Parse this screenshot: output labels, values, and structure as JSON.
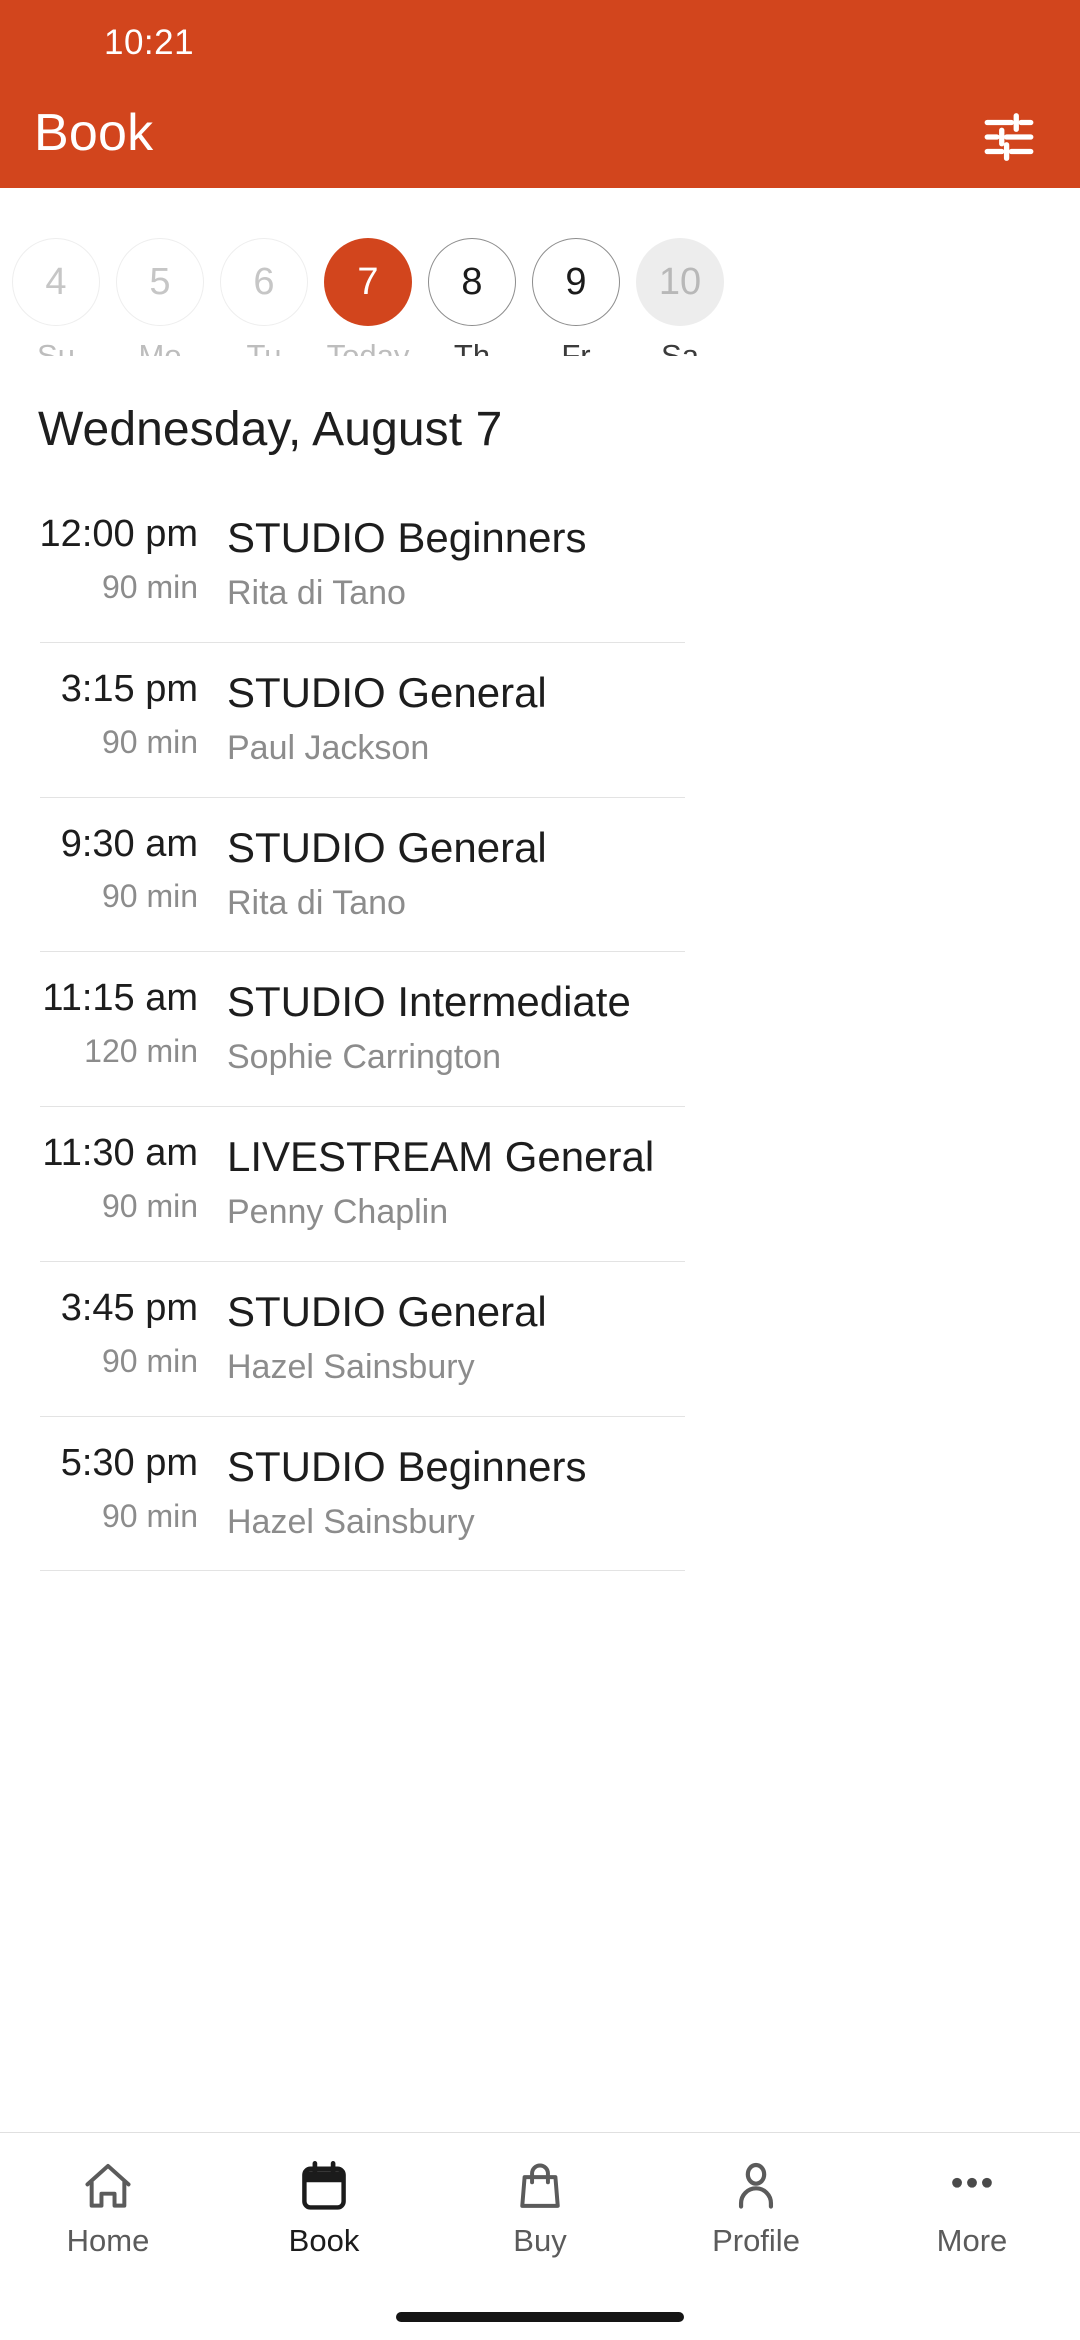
{
  "status_bar": {
    "time": "10:21"
  },
  "app_bar": {
    "title": "Book",
    "filter_icon": "filter-tune-icon",
    "background_color": "#d2451d",
    "text_color": "#ffffff"
  },
  "date_strip": {
    "days": [
      {
        "number": "4",
        "label": "Su",
        "state": "past"
      },
      {
        "number": "5",
        "label": "Mo",
        "state": "past"
      },
      {
        "number": "6",
        "label": "Tu",
        "state": "past"
      },
      {
        "number": "7",
        "label": "Today",
        "state": "today"
      },
      {
        "number": "8",
        "label": "Th",
        "state": "future"
      },
      {
        "number": "9",
        "label": "Fr",
        "state": "future"
      },
      {
        "number": "10",
        "label": "Sa",
        "state": "disabled"
      }
    ],
    "selected_color": "#d2451d"
  },
  "schedule": {
    "date_heading": "Wednesday, August 7",
    "classes": [
      {
        "time": "12:00 pm",
        "duration": "90 min",
        "name": "STUDIO Beginners",
        "instructor": "Rita di Tano"
      },
      {
        "time": "3:15 pm",
        "duration": "90 min",
        "name": "STUDIO General",
        "instructor": "Paul Jackson"
      },
      {
        "time": "9:30 am",
        "duration": "90 min",
        "name": "STUDIO General",
        "instructor": "Rita di Tano"
      },
      {
        "time": "11:15 am",
        "duration": "120 min",
        "name": "STUDIO Intermediate",
        "instructor": "Sophie Carrington"
      },
      {
        "time": "11:30 am",
        "duration": "90 min",
        "name": "LIVESTREAM General",
        "instructor": "Penny Chaplin"
      },
      {
        "time": "3:45 pm",
        "duration": "90 min",
        "name": "STUDIO General",
        "instructor": "Hazel Sainsbury"
      },
      {
        "time": "5:30 pm",
        "duration": "90 min",
        "name": "STUDIO Beginners",
        "instructor": "Hazel Sainsbury"
      }
    ]
  },
  "bottom_nav": {
    "items": [
      {
        "label": "Home",
        "icon": "home-icon",
        "active": false
      },
      {
        "label": "Book",
        "icon": "calendar-icon",
        "active": true
      },
      {
        "label": "Buy",
        "icon": "bag-icon",
        "active": false
      },
      {
        "label": "Profile",
        "icon": "person-icon",
        "active": false
      },
      {
        "label": "More",
        "icon": "ellipsis-icon",
        "active": false
      }
    ]
  }
}
